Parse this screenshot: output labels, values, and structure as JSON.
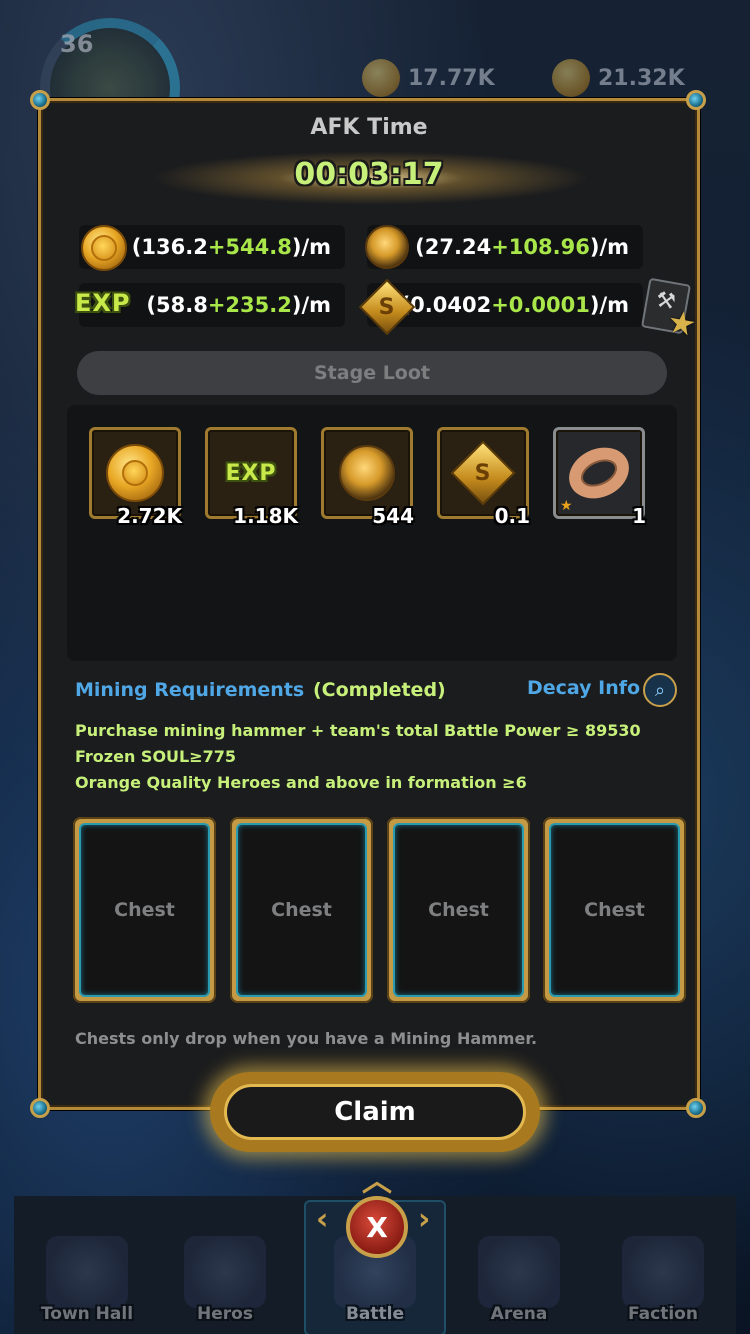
{
  "hud": {
    "level": "36",
    "gold": "17.77K",
    "orbs": "21.32K"
  },
  "panel": {
    "title": "AFK Time",
    "timer": "00:03:17",
    "rates": {
      "gold": {
        "base": "(136.2",
        "bonus": "+544.8",
        "unit": ")/m"
      },
      "orb": {
        "base": "(27.24",
        "bonus": "+108.96",
        "unit": ")/m"
      },
      "exp": {
        "base": "(58.8",
        "bonus": "+235.2",
        "unit": ")/m"
      },
      "soul": {
        "base": "(0.0402",
        "bonus": "+0.0001",
        "unit": ")/m"
      }
    },
    "exp_icon_label": "EXP",
    "soul_icon_label": "S",
    "stage_loot_label": "Stage Loot",
    "loot": [
      {
        "icon": "gold-coin-icon",
        "count": "2.72K"
      },
      {
        "icon": "exp-icon",
        "label": "EXP",
        "count": "1.18K"
      },
      {
        "icon": "orb-icon",
        "count": "544"
      },
      {
        "icon": "soul-icon",
        "label": "S",
        "count": "0.1"
      },
      {
        "icon": "ring-icon",
        "count": "1"
      }
    ],
    "requirements": {
      "title": "Mining Requirements",
      "status": "(Completed)",
      "decay_info": "Decay Info",
      "lines": [
        "Purchase mining hammer + team's total Battle Power ≥ 89530",
        "Frozen SOUL≥775",
        "Orange Quality Heroes and above in formation ≥6"
      ]
    },
    "chests": [
      "Chest",
      "Chest",
      "Chest",
      "Chest"
    ],
    "chest_note": "Chests only drop when you have a Mining Hammer.",
    "claim_label": "Claim"
  },
  "nav": {
    "items": [
      "Town Hall",
      "Heros",
      "Battle",
      "Arena",
      "Faction"
    ],
    "close_label": "X"
  },
  "colors": {
    "accent_gold": "#c9a04a",
    "bonus_green": "#a8e64a",
    "link_blue": "#4fa7e6"
  }
}
